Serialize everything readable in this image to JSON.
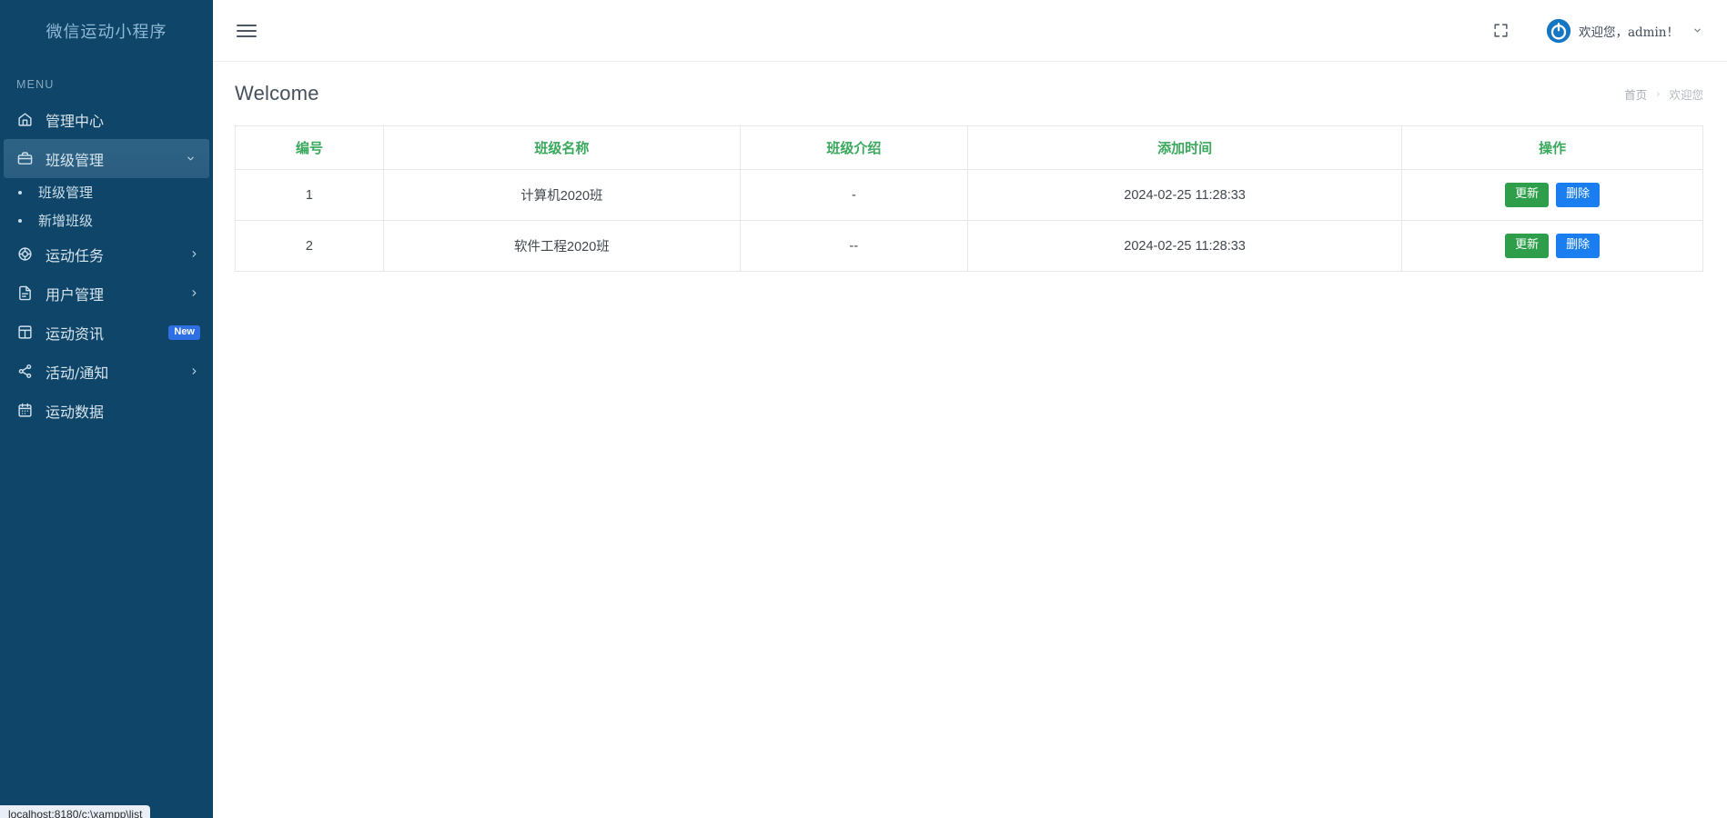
{
  "sidebar": {
    "brand": "微信运动小程序",
    "menu_label": "MENU",
    "items": [
      {
        "label": "管理中心",
        "icon": "home-icon",
        "arrow": "",
        "badge": ""
      },
      {
        "label": "班级管理",
        "icon": "briefcase-icon",
        "arrow": "chevron-down-icon",
        "badge": "",
        "active": true
      },
      {
        "label": "运动任务",
        "icon": "target-icon",
        "arrow": "chevron-right-icon",
        "badge": ""
      },
      {
        "label": "用户管理",
        "icon": "document-icon",
        "arrow": "chevron-right-icon",
        "badge": ""
      },
      {
        "label": "运动资讯",
        "icon": "layout-icon",
        "arrow": "",
        "badge": "New"
      },
      {
        "label": "活动/通知",
        "icon": "share-icon",
        "arrow": "chevron-right-icon",
        "badge": ""
      },
      {
        "label": "运动数据",
        "icon": "calendar-icon",
        "arrow": "",
        "badge": ""
      }
    ],
    "submenu": [
      {
        "label": "班级管理"
      },
      {
        "label": "新增班级"
      }
    ],
    "status_bar": "localhost:8180/c:\\xampp\\list"
  },
  "topbar": {
    "menu_toggle_icon": "hamburger-icon",
    "fullscreen_icon": "fullscreen-icon",
    "avatar_icon": "power-avatar-icon",
    "user_greeting": "欢迎您，admin！",
    "caret_icon": "chevron-down-icon"
  },
  "page": {
    "title": "Welcome",
    "breadcrumb": {
      "home": "首页",
      "separator": "›",
      "current": "欢迎您"
    }
  },
  "table": {
    "columns": [
      "编号",
      "班级名称",
      "班级介绍",
      "添加时间",
      "操作"
    ],
    "rows": [
      {
        "id": "1",
        "name": "计算机2020班",
        "intro": "-",
        "time": "2024-02-25 11:28:33",
        "update_label": "更新",
        "delete_label": "删除"
      },
      {
        "id": "2",
        "name": "软件工程2020班",
        "intro": "--",
        "time": "2024-02-25 11:28:33",
        "update_label": "更新",
        "delete_label": "删除"
      }
    ]
  },
  "colors": {
    "sidebar_bg": "#0f4568",
    "sidebar_active": "#2d6183",
    "header_green": "#3aa85d",
    "btn_update": "#2e9e4b",
    "btn_delete": "#1a7ef0",
    "badge_new": "#2f6fe4"
  }
}
